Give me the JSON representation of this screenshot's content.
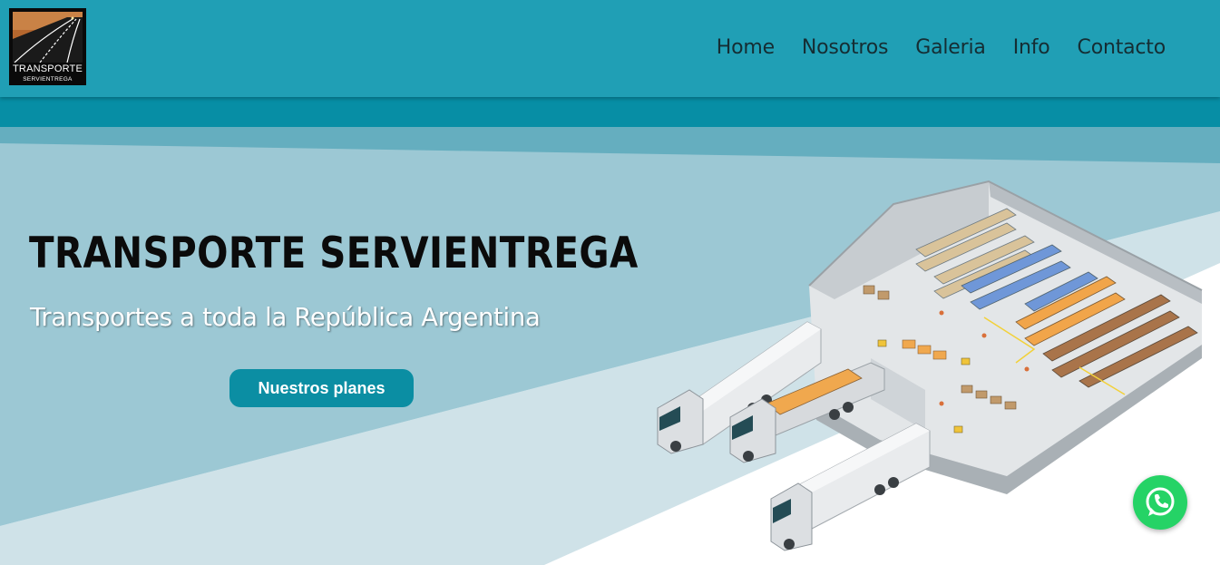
{
  "brand": {
    "logo_title": "TRANSPORTE",
    "logo_subtitle": "SERVIENTREGA"
  },
  "nav": {
    "items": [
      {
        "label": "Home"
      },
      {
        "label": "Nosotros"
      },
      {
        "label": "Galeria"
      },
      {
        "label": "Info"
      },
      {
        "label": "Contacto"
      }
    ]
  },
  "hero": {
    "title": "TRANSPORTE SERVIENTREGA",
    "subtitle": "Transportes a toda la República Argentina",
    "cta_label": "Nuestros planes",
    "illustration": "warehouse-with-trucks-illustration"
  },
  "floating": {
    "whatsapp_icon": "whatsapp-icon"
  },
  "colors": {
    "header": "#209fb5",
    "subband": "#078ea5",
    "hero_light": "#9cc8d4",
    "accent_button": "#0b8ea3",
    "whatsapp": "#25d366"
  }
}
